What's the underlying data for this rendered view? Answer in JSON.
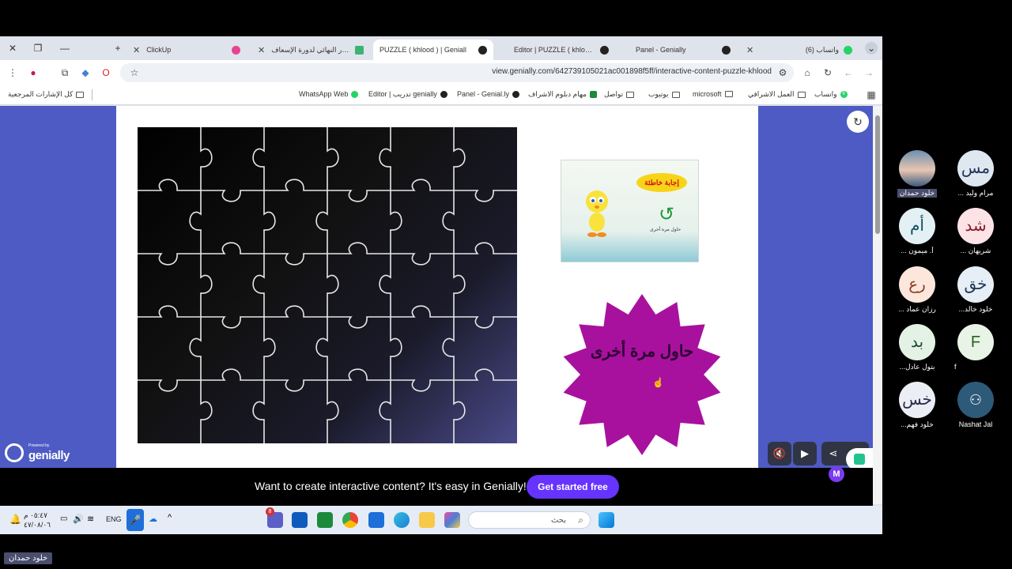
{
  "browser": {
    "tabs": [
      {
        "label": "واتساب (6)",
        "badge": "6",
        "color": "#25d366"
      },
      {
        "label": "Panel - Genially",
        "color": "#333"
      },
      {
        "label": "Editor | PUZZLE ( khlood )",
        "color": "#333"
      },
      {
        "label": "PUZZLE ( khlood ) | Geniall",
        "color": "#333"
      },
      {
        "label": "الاختبار النهائي لدورة الإسعاف",
        "color": "#3cb371"
      },
      {
        "label": "ClickUp",
        "color": "#e84393"
      }
    ],
    "url": "view.genially.com/642739105021ac001898f5ff/interactive-content-puzzle-khlood",
    "bookmarks": [
      {
        "label": "كل الإشارات المرجعية"
      },
      {
        "label": "WhatsApp Web"
      },
      {
        "label": "Editor | تدريب genially"
      },
      {
        "label": "Panel - Genial.ly"
      },
      {
        "label": "مهام دبلوم الاشراف"
      },
      {
        "label": "تواصل"
      },
      {
        "label": "يوتيوب"
      },
      {
        "label": "microsoft"
      },
      {
        "label": "العمل الاشرافي"
      },
      {
        "label": "واتساب",
        "badge": "6"
      }
    ]
  },
  "slide": {
    "wrong_bubble": "إجابة خاطئة",
    "card_caption": "حاول مرة أخرى",
    "star_text": "حاول مرة أخرى"
  },
  "genially": {
    "powered": "Powered by",
    "brand": "genially",
    "banner_text": "Want to create interactive content? It's easy in Genially!",
    "cta": "Get started free",
    "m_badge": "M"
  },
  "taskbar": {
    "search_placeholder": "بحث",
    "lang": "ENG",
    "time": "٠٥:٤٧ م",
    "date": "٤٧/٠٨/٠٦",
    "teams_badge": "8"
  },
  "participants": [
    {
      "initials": "مس",
      "name": "... مرام وليد",
      "bg": "#dfe8f0",
      "fg": "#1d3557"
    },
    {
      "initials": "",
      "name": "خلود حمدان",
      "bg": "#b9c7d9",
      "fg": "#fff",
      "photo": true
    },
    {
      "initials": "شد",
      "name": "... شريهان",
      "bg": "#fbe3e6",
      "fg": "#8a1c2b"
    },
    {
      "initials": "أم",
      "name": "... أ. ميمون",
      "bg": "#e3f1f4",
      "fg": "#0b4f5c"
    },
    {
      "initials": "خق",
      "name": "...خلود خالد",
      "bg": "#e6eef6",
      "fg": "#1d3557"
    },
    {
      "initials": "رع",
      "name": "... رزان عماد",
      "bg": "#fde6dc",
      "fg": "#8a3c1c"
    },
    {
      "initials": "F",
      "name": "f",
      "bg": "#e8f4e6",
      "fg": "#2b5d24"
    },
    {
      "initials": "بد",
      "name": "...بتول عادل",
      "bg": "#e4f2e6",
      "fg": "#1e4d2b"
    },
    {
      "initials": "",
      "name": "Nashat Jal",
      "bg": "#2e5a7a",
      "fg": "#fff",
      "person": true
    },
    {
      "initials": "خس",
      "name": "...خلود فهم",
      "bg": "#eceef5",
      "fg": "#2a2a4a"
    }
  ],
  "self_tag": "خلود حمدان"
}
